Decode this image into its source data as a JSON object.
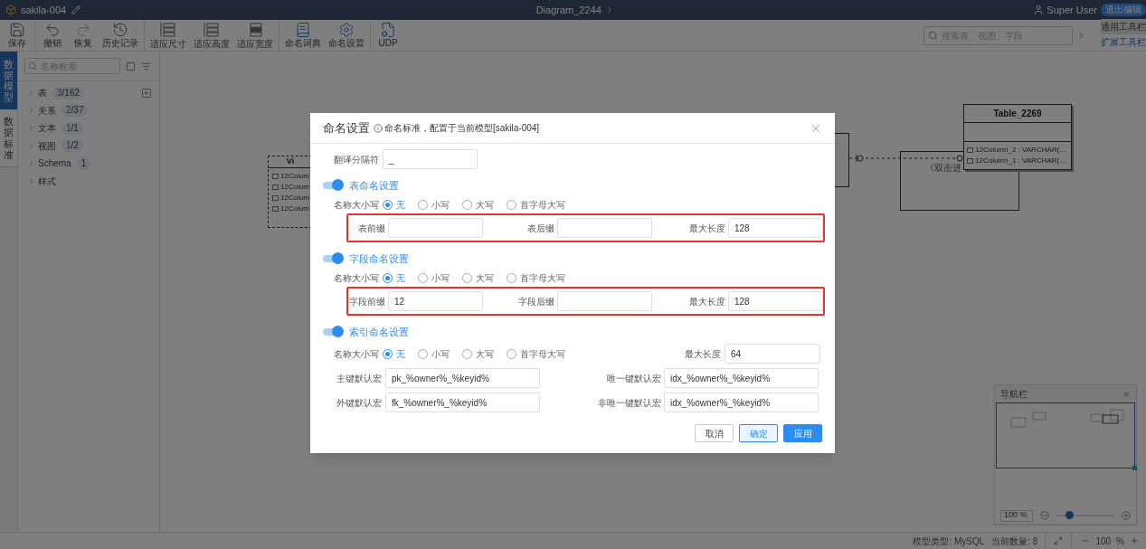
{
  "app": {
    "project": "sakila-004",
    "diagram": "Diagram_2244",
    "user": "Super User",
    "exit_button": "退出编辑"
  },
  "toolbar": {
    "groups": [
      [
        {
          "label": "保存"
        }
      ],
      [
        {
          "label": "撤销"
        },
        {
          "label": "恢复"
        },
        {
          "label": "历史记录"
        }
      ],
      [
        {
          "label": "适应尺寸"
        },
        {
          "label": "适应高度"
        },
        {
          "label": "适应宽度"
        }
      ],
      [
        {
          "label": "命名词典"
        },
        {
          "label": "命名设置"
        }
      ],
      [
        {
          "label": "UDP"
        }
      ]
    ],
    "search": {
      "placeholder": "搜索表、视图、字段"
    },
    "tabs": [
      {
        "label": "通用工具栏",
        "selected": true
      },
      {
        "label": "扩展工具栏",
        "selected": false
      }
    ]
  },
  "side_tabs": [
    {
      "label": "数据模型",
      "selected": true
    },
    {
      "label": "数据标准",
      "selected": false
    }
  ],
  "sidebar": {
    "search": {
      "placeholder": "名称检索"
    },
    "items": [
      {
        "label": "表",
        "badge": [
          {
            "text": "3",
            "highlight": true
          },
          {
            "text": "/162",
            "highlight": false
          }
        ]
      },
      {
        "label": "关系",
        "badge": [
          {
            "text": "2",
            "highlight": true
          },
          {
            "text": "/37",
            "highlight": false
          }
        ]
      },
      {
        "label": "文本",
        "badge": [
          {
            "text": "1",
            "highlight": true
          },
          {
            "text": "/1",
            "highlight": false
          }
        ]
      },
      {
        "label": "视图",
        "badge": [
          {
            "text": "1",
            "highlight": true
          },
          {
            "text": "/2",
            "highlight": false
          }
        ]
      },
      {
        "label": "Schema",
        "badge": [
          {
            "text": "1",
            "highlight": false
          }
        ]
      },
      {
        "label": "样式"
      }
    ]
  },
  "canvas": {
    "view_node": {
      "title": "Vi",
      "rows": [
        "12Colum",
        "12Colum",
        "12Colum",
        "12Colum"
      ]
    },
    "hint": "《双击进",
    "table": {
      "title": "Table_2269",
      "rows": [
        "12Column_2 : VARCHAR(...",
        "12Column_1 : VARCHAR(..."
      ]
    }
  },
  "navigator": {
    "title": "导航栏",
    "zoom": "100 %",
    "slider": {
      "level": 0.22
    }
  },
  "status_bar": {
    "model_type": "模型类型: MySQL",
    "count": "当前数量: 8",
    "zoom": "100",
    "unit": "%"
  },
  "dialog": {
    "title": "命名设置",
    "hint": "命名标准，配置于当前模型[sakila-004]",
    "separator": {
      "label": "翻译分隔符",
      "value": "_"
    },
    "sections": [
      {
        "title": "表命名设置",
        "on": true,
        "highlighted": true,
        "case": {
          "label": "名称大小写",
          "options": [
            {
              "label": "无",
              "selected": true
            },
            {
              "label": "小写",
              "selected": false
            },
            {
              "label": "大写",
              "selected": false
            },
            {
              "label": "首字母大写",
              "selected": false
            }
          ]
        },
        "fields": [
          {
            "label": "表前缀"
          },
          {
            "label": "表后缀"
          },
          {
            "label": "最大长度",
            "value": "128"
          }
        ]
      },
      {
        "title": "字段命名设置",
        "on": true,
        "highlighted": true,
        "case": {
          "label": "名称大小写",
          "options": [
            {
              "label": "无",
              "selected": true
            },
            {
              "label": "小写",
              "selected": false
            },
            {
              "label": "大写",
              "selected": false
            },
            {
              "label": "首字母大写",
              "selected": false
            }
          ]
        },
        "fields": [
          {
            "label": "字段前缀",
            "value": "12"
          },
          {
            "label": "字段后缀"
          },
          {
            "label": "最大长度",
            "value": "128"
          }
        ]
      },
      {
        "title": "索引命名设置",
        "on": true,
        "case": {
          "label": "名称大小写",
          "options": [
            {
              "label": "无",
              "selected": true
            },
            {
              "label": "小写",
              "selected": false
            },
            {
              "label": "大写",
              "selected": false
            },
            {
              "label": "首字母大写",
              "selected": false
            }
          ]
        },
        "max_length": {
          "label": "最大长度",
          "value": "64"
        },
        "macros": [
          {
            "label": "主键默认宏",
            "value": "pk_%owner%_%keyid%"
          },
          {
            "label": "唯一键默认宏",
            "value": "idx_%owner%_%keyid%"
          },
          {
            "label": "外键默认宏",
            "value": "fk_%owner%_%keyid%"
          },
          {
            "label": "非唯一键默认宏",
            "value": "idx_%owner%_%keyid%"
          }
        ]
      }
    ],
    "buttons": [
      {
        "label": "取消",
        "kind": "default"
      },
      {
        "label": "确定",
        "kind": "secondary"
      },
      {
        "label": "应用",
        "kind": "primary"
      }
    ]
  }
}
